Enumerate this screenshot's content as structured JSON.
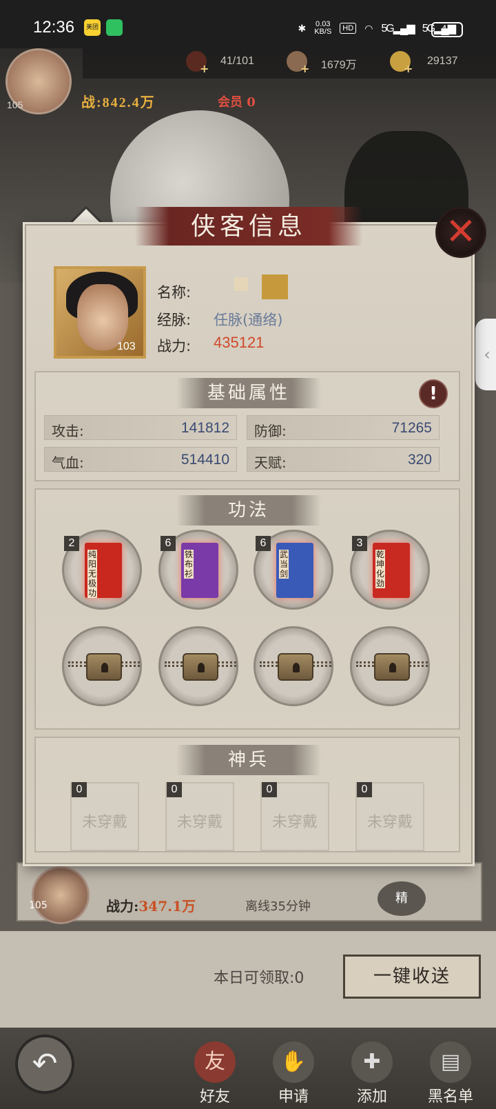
{
  "status_bar": {
    "time": "12:36",
    "app1": "美团",
    "net_speed_value": "0.03",
    "net_speed_unit": "KB/S",
    "hd": "HD",
    "signal1": "5G",
    "signal2": "5G",
    "battery": "40"
  },
  "header": {
    "player_level": "105",
    "stamina": "41/101",
    "coins": "1679万",
    "gold": "29137",
    "power": "战:842.4万",
    "vip": "会员 0",
    "tab_char": "好"
  },
  "dialog": {
    "title": "侠客信息",
    "hero_level": "103",
    "name_label": "名称:",
    "meridian_label": "经脉:",
    "meridian_value": "任脉(通络)",
    "power_label": "战力:",
    "power_value": "435121",
    "basic_section": "基础属性",
    "stats": [
      {
        "label": "攻击:",
        "value": "141812"
      },
      {
        "label": "防御:",
        "value": "71265"
      },
      {
        "label": "气血:",
        "value": "514410"
      },
      {
        "label": "天赋:",
        "value": "320"
      }
    ],
    "skills_section": "功法",
    "skills": [
      {
        "level": "2",
        "title": "纯阳无极功",
        "color": "#c8281e"
      },
      {
        "level": "6",
        "title": "铁布衫",
        "color": "#7a3aa8"
      },
      {
        "level": "6",
        "title": "武当剑",
        "color": "#3a5ab8"
      },
      {
        "level": "3",
        "title": "乾坤化劲",
        "color": "#c82a22"
      }
    ],
    "weapons_section": "神兵",
    "weapons": [
      {
        "count": "0",
        "label": "未穿戴"
      },
      {
        "count": "0",
        "label": "未穿戴"
      },
      {
        "count": "0",
        "label": "未穿戴"
      },
      {
        "count": "0",
        "label": "未穿戴"
      }
    ]
  },
  "background_list": {
    "friend_level": "105",
    "friend_power_label": "战力:",
    "friend_power_value": "347.1万",
    "offline": "离线35分钟",
    "action": "精"
  },
  "footer": {
    "daily_label": "本日可领取:0",
    "collect_button": "一键收送"
  },
  "nav": [
    {
      "label": "好友",
      "icon": "friends-icon"
    },
    {
      "label": "申请",
      "icon": "handshake-icon"
    },
    {
      "label": "添加",
      "icon": "add-friend-icon"
    },
    {
      "label": "黑名单",
      "icon": "blacklist-icon"
    }
  ],
  "colors": {
    "accent": "#d0482a",
    "title_band": "#7a2c26"
  }
}
